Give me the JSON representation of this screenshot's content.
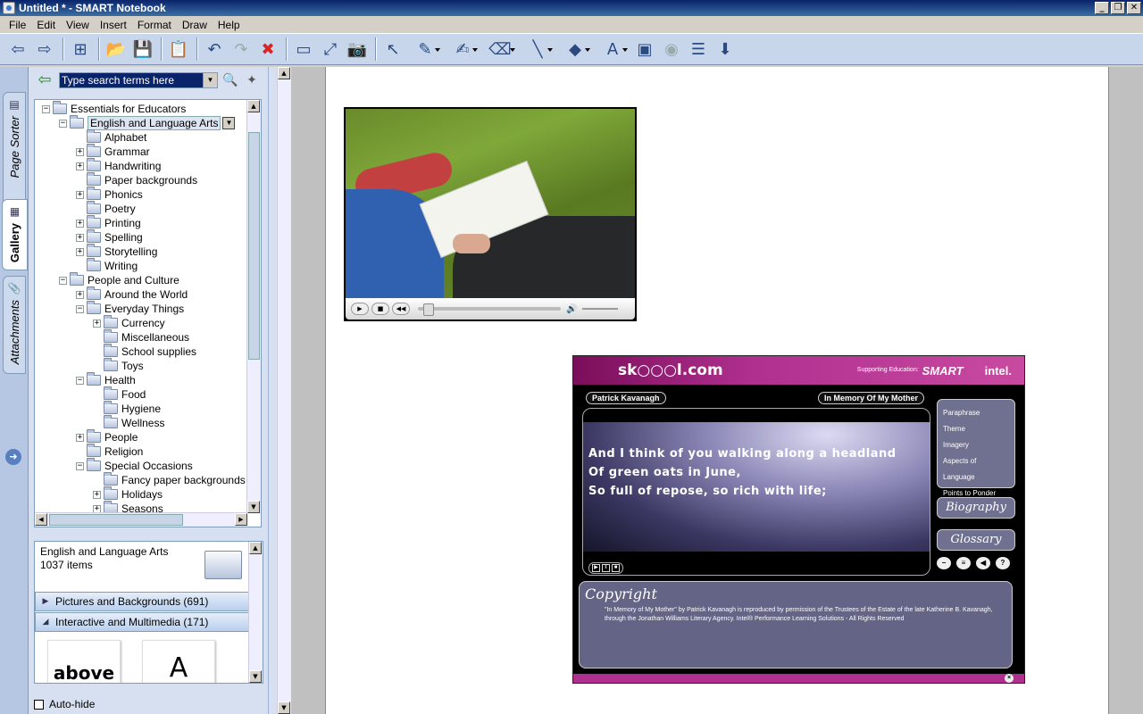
{
  "window": {
    "title": "Untitled * - SMART Notebook",
    "buttons": [
      "_",
      "❐",
      "✕"
    ]
  },
  "menu": [
    "File",
    "Edit",
    "View",
    "Insert",
    "Format",
    "Draw",
    "Help"
  ],
  "toolbar": {
    "buttons": [
      {
        "name": "previous-page-icon",
        "glyph": "⇦"
      },
      {
        "name": "next-page-icon",
        "glyph": "⇨"
      },
      {
        "name": "add-page-icon",
        "glyph": "⊞"
      },
      {
        "name": "open-file-icon",
        "glyph": "📂"
      },
      {
        "name": "save-icon",
        "glyph": "💾"
      },
      {
        "name": "paste-icon",
        "glyph": "📋"
      },
      {
        "name": "undo-icon",
        "glyph": "↶"
      },
      {
        "name": "redo-icon",
        "glyph": "↷"
      },
      {
        "name": "delete-icon",
        "glyph": "✖"
      },
      {
        "name": "screen-shade-icon",
        "glyph": "▭"
      },
      {
        "name": "full-screen-icon",
        "glyph": "⤢"
      },
      {
        "name": "capture-icon",
        "glyph": "📷"
      },
      {
        "name": "select-icon",
        "glyph": "↖"
      },
      {
        "name": "pen-icon",
        "glyph": "✎"
      },
      {
        "name": "creative-pen-icon",
        "glyph": "✍"
      },
      {
        "name": "eraser-icon",
        "glyph": "⌫"
      },
      {
        "name": "line-icon",
        "glyph": "╲"
      },
      {
        "name": "shapes-icon",
        "glyph": "◆"
      },
      {
        "name": "text-icon",
        "glyph": "A"
      },
      {
        "name": "properties-icon",
        "glyph": "▣"
      },
      {
        "name": "fill-icon",
        "glyph": "◉"
      },
      {
        "name": "toolbar-options-icon",
        "glyph": "☰"
      },
      {
        "name": "move-toolbar-icon",
        "glyph": "⬇"
      }
    ]
  },
  "tabs": {
    "page_sorter": "Page Sorter",
    "gallery": "Gallery",
    "attachments": "Attachments"
  },
  "gallery": {
    "search_placeholder": "Type search terms here",
    "tree": [
      {
        "label": "Essentials for Educators",
        "level": 0,
        "exp": "−"
      },
      {
        "label": "English and Language Arts",
        "level": 1,
        "exp": "−",
        "selected": true
      },
      {
        "label": "Alphabet",
        "level": 2,
        "exp": ""
      },
      {
        "label": "Grammar",
        "level": 2,
        "exp": "+"
      },
      {
        "label": "Handwriting",
        "level": 2,
        "exp": "+"
      },
      {
        "label": "Paper backgrounds",
        "level": 2,
        "exp": ""
      },
      {
        "label": "Phonics",
        "level": 2,
        "exp": "+"
      },
      {
        "label": "Poetry",
        "level": 2,
        "exp": ""
      },
      {
        "label": "Printing",
        "level": 2,
        "exp": "+"
      },
      {
        "label": "Spelling",
        "level": 2,
        "exp": "+"
      },
      {
        "label": "Storytelling",
        "level": 2,
        "exp": "+"
      },
      {
        "label": "Writing",
        "level": 2,
        "exp": ""
      },
      {
        "label": "People and Culture",
        "level": 1,
        "exp": "−"
      },
      {
        "label": "Around the World",
        "level": 2,
        "exp": "+"
      },
      {
        "label": "Everyday Things",
        "level": 2,
        "exp": "−"
      },
      {
        "label": "Currency",
        "level": 3,
        "exp": "+"
      },
      {
        "label": "Miscellaneous",
        "level": 3,
        "exp": ""
      },
      {
        "label": "School supplies",
        "level": 3,
        "exp": ""
      },
      {
        "label": "Toys",
        "level": 3,
        "exp": ""
      },
      {
        "label": "Health",
        "level": 2,
        "exp": "−"
      },
      {
        "label": "Food",
        "level": 3,
        "exp": ""
      },
      {
        "label": "Hygiene",
        "level": 3,
        "exp": ""
      },
      {
        "label": "Wellness",
        "level": 3,
        "exp": ""
      },
      {
        "label": "People",
        "level": 2,
        "exp": "+"
      },
      {
        "label": "Religion",
        "level": 2,
        "exp": ""
      },
      {
        "label": "Special Occasions",
        "level": 2,
        "exp": "−"
      },
      {
        "label": "Fancy paper backgrounds",
        "level": 3,
        "exp": ""
      },
      {
        "label": "Holidays",
        "level": 3,
        "exp": "+"
      },
      {
        "label": "Seasons",
        "level": 3,
        "exp": "+"
      }
    ],
    "detail": {
      "title": "English and Language Arts",
      "count": "1037 items",
      "categories": [
        {
          "label": "Pictures and Backgrounds (691)",
          "arrow": "▶"
        },
        {
          "label": "Interactive and Multimedia (171)",
          "arrow": "◢"
        }
      ],
      "thumbs": [
        "above",
        "A"
      ]
    },
    "autohide": "Auto-hide"
  },
  "skool": {
    "logo": "sk○○○l.com",
    "support": "Supporting\nEducation:",
    "smart": "SMART",
    "intel": "intel.",
    "author": "Patrick Kavanagh",
    "poem_title": "In Memory Of My Mother",
    "poem_lines": [
      "And I think of you walking along a headland",
      "Of green oats in June,",
      "So full of repose, so rich with life;"
    ],
    "links": [
      "Paraphrase",
      "Theme",
      "Imagery",
      "Aspects of Language",
      "Points to Ponder"
    ],
    "biography": "Biography",
    "glossary": "Glossary",
    "copyright_title": "Copyright",
    "copyright_text": "\"In Memory of My Mother\" by Patrick Kavanagh is reproduced by permission of the Trustees of the Estate of the late Katherine B. Kavanagh, through the Jonathan Williams Literary Agency. Intel® Performance Learning Solutions - All Rights Reserved"
  }
}
